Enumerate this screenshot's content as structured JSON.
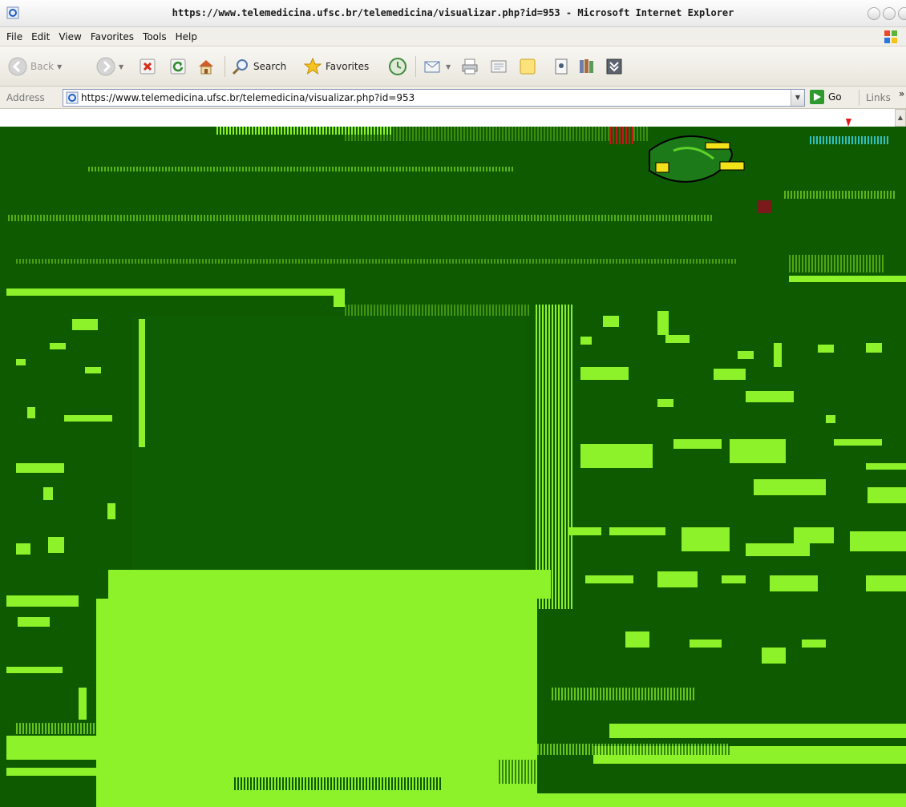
{
  "window": {
    "title": "https://www.telemedicina.ufsc.br/telemedicina/visualizar.php?id=953 - Microsoft Internet Explorer"
  },
  "menu": {
    "items": [
      "File",
      "Edit",
      "View",
      "Favorites",
      "Tools",
      "Help"
    ]
  },
  "toolbar": {
    "back_label": "Back",
    "search_label": "Search",
    "favorites_label": "Favorites"
  },
  "address": {
    "label": "Address",
    "url": "https://www.telemedicina.ufsc.br/telemedicina/visualizar.php?id=953",
    "go_label": "Go",
    "links_label": "Links"
  },
  "colors": {
    "corrupt_dark": "#0d5a00",
    "corrupt_light": "#8ef22a"
  },
  "icons": {
    "back": "back-arrow-icon",
    "forward": "forward-arrow-icon",
    "stop": "stop-icon",
    "refresh": "refresh-icon",
    "home": "home-icon",
    "search": "search-icon",
    "favorites": "favorites-star-icon",
    "history": "history-icon",
    "mail": "mail-icon",
    "print": "print-icon",
    "edit": "edit-icon",
    "discuss": "discuss-icon",
    "messenger": "messenger-icon",
    "research": "research-icon",
    "extra": "extra-tool-icon"
  }
}
